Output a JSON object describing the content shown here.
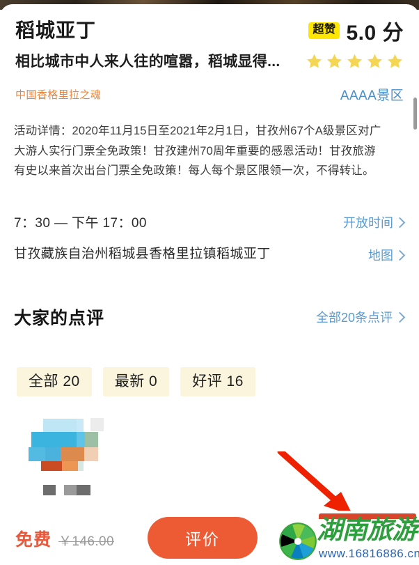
{
  "header": {
    "poi_title": "稻城亚丁",
    "super_badge": "超赞",
    "score": "5.0 分",
    "star_count": 5,
    "star_color": "#f5d653"
  },
  "tagline": "相比城市中人来人往的喧嚣，稻城显得...",
  "subtitle": {
    "text": "中国香格里拉之魂",
    "color": "#e8853c"
  },
  "level_tag": {
    "text": "AAAA景区",
    "color": "#4a8fc7"
  },
  "activity": {
    "text": "活动详情：2020年11月15日至2021年2月1日，甘孜州67个A级景区对广大游人实行门票全免政策！甘孜建州70周年重要的感恩活动！甘孜旅游有史以来首次出台门票全免政策！每人每个景区限领一次，不得转让。"
  },
  "info": {
    "hours_value": "7：30 — 下午 17：00",
    "hours_link": "开放时间",
    "address_value": "甘孜藏族自治州稻城县香格里拉镇稻城亚丁",
    "address_link": "地图"
  },
  "reviews": {
    "title": "大家的点评",
    "all_link": "全部20条点评",
    "chips": [
      {
        "label": "全部 20"
      },
      {
        "label": "最新 0"
      },
      {
        "label": "好评 16"
      }
    ]
  },
  "bottom": {
    "price_free": "免费",
    "price_original": "￥146.00",
    "cta_label": "评价",
    "cta_color": "#ed5b35"
  },
  "watermark": {
    "brand": "湖南旅游",
    "url": "www.16816886.cn",
    "brand_color": "#2f9e3e",
    "url_color": "#2764b5"
  },
  "annotation": {
    "arrow_color": "#ee2200"
  }
}
